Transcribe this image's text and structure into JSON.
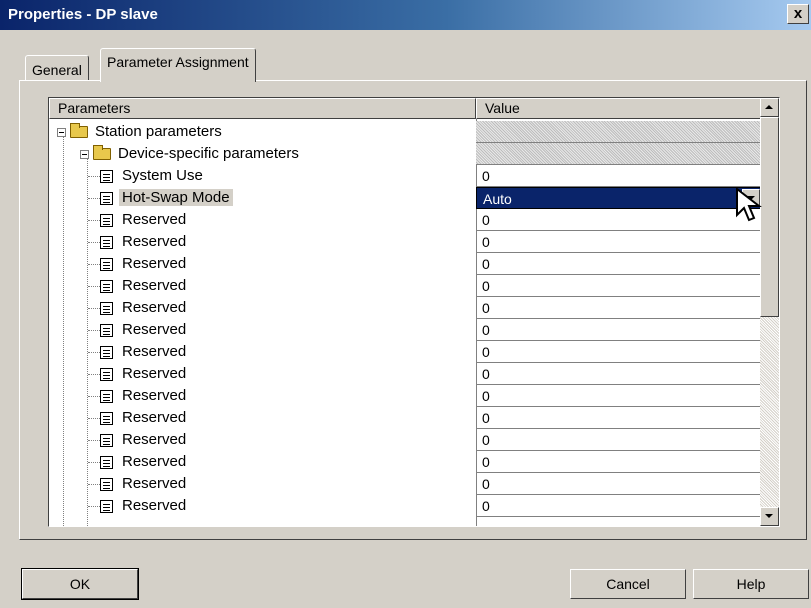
{
  "window": {
    "title": "Properties - DP slave",
    "close_label": "x"
  },
  "tabs": [
    {
      "label": "General"
    },
    {
      "label": "Parameter Assignment"
    }
  ],
  "grid": {
    "headers": {
      "parameters": "Parameters",
      "value": "Value"
    },
    "rows": [
      {
        "name": "Station parameters",
        "value": ""
      },
      {
        "name": "Device-specific parameters",
        "value": ""
      },
      {
        "name": "System Use",
        "value": "0"
      },
      {
        "name": "Hot-Swap Mode",
        "value": "Auto"
      },
      {
        "name": "Reserved",
        "value": "0"
      },
      {
        "name": "Reserved",
        "value": "0"
      },
      {
        "name": "Reserved",
        "value": "0"
      },
      {
        "name": "Reserved",
        "value": "0"
      },
      {
        "name": "Reserved",
        "value": "0"
      },
      {
        "name": "Reserved",
        "value": "0"
      },
      {
        "name": "Reserved",
        "value": "0"
      },
      {
        "name": "Reserved",
        "value": "0"
      },
      {
        "name": "Reserved",
        "value": "0"
      },
      {
        "name": "Reserved",
        "value": "0"
      },
      {
        "name": "Reserved",
        "value": "0"
      },
      {
        "name": "Reserved",
        "value": "0"
      },
      {
        "name": "Reserved",
        "value": "0"
      },
      {
        "name": "Reserved",
        "value": "0"
      }
    ]
  },
  "buttons": {
    "ok": "OK",
    "cancel": "Cancel",
    "help": "Help"
  },
  "colors": {
    "titlebar": "#0a246a",
    "selection": "#0a246a",
    "face": "#d4d0c8"
  }
}
